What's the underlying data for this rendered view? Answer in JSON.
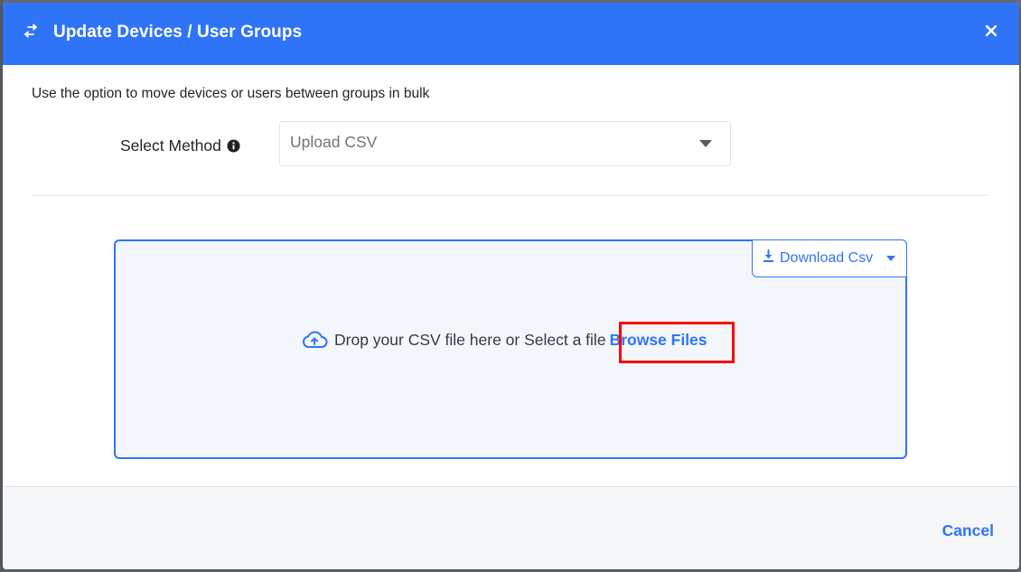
{
  "modal": {
    "title": "Update Devices / User Groups",
    "description": "Use the option to move devices or users between groups in bulk"
  },
  "method": {
    "label": "Select Method",
    "selected": "Upload CSV"
  },
  "dropzone": {
    "text": "Drop your CSV file here or Select a file",
    "browse_label": "Browse Files",
    "download_label": "Download Csv"
  },
  "footer": {
    "cancel_label": "Cancel"
  },
  "icons": {
    "header": "swap-arrows-icon",
    "close": "close-icon",
    "info": "info-icon",
    "select_caret": "chevron-down-icon",
    "download": "download-icon",
    "cloud": "cloud-upload-icon"
  },
  "colors": {
    "accent": "#2f74f7",
    "highlight": "#ff0000",
    "dropzone_bg": "#f3f7fb"
  }
}
